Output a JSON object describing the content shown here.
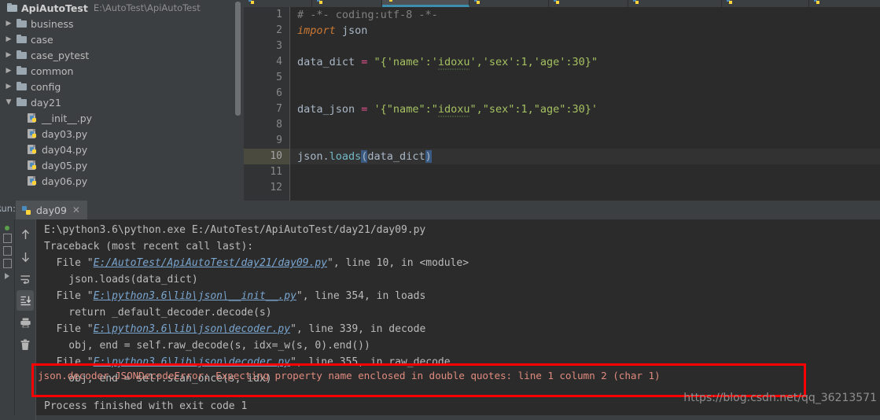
{
  "project": {
    "root": {
      "label": "ApiAutoTest",
      "path": "E:\\AutoTest\\ApiAutoTest",
      "icon": "folder-icon"
    },
    "items": [
      {
        "label": "business",
        "type": "folder",
        "expanded": false,
        "indent": 0
      },
      {
        "label": "case",
        "type": "folder",
        "expanded": false,
        "indent": 0
      },
      {
        "label": "case_pytest",
        "type": "folder",
        "expanded": false,
        "indent": 0
      },
      {
        "label": "common",
        "type": "folder",
        "expanded": false,
        "indent": 0
      },
      {
        "label": "config",
        "type": "folder",
        "expanded": false,
        "indent": 0
      },
      {
        "label": "day21",
        "type": "folder",
        "expanded": true,
        "indent": 0
      },
      {
        "label": "__init__.py",
        "type": "python",
        "indent": 1
      },
      {
        "label": "day03.py",
        "type": "python",
        "indent": 1
      },
      {
        "label": "day04.py",
        "type": "python",
        "indent": 1
      },
      {
        "label": "day05.py",
        "type": "python",
        "indent": 1
      },
      {
        "label": "day06.py",
        "type": "python",
        "indent": 1
      }
    ]
  },
  "editor": {
    "line_numbers": [
      "1",
      "2",
      "3",
      "4",
      "5",
      "6",
      "7",
      "8",
      "9",
      "10",
      "11",
      "12"
    ],
    "current_line": "10",
    "lines": [
      "# -*- coding:utf-8 -*-",
      "import json",
      "",
      "data_dict = \"{'name':'idoxu','sex':1,'age':30}\"",
      "",
      "",
      "data_json = '{\"name\":\"idoxu\",\"sex\":1,\"age\":30}'",
      "",
      "",
      "json.loads(data_dict)",
      "",
      ""
    ]
  },
  "run_panel": {
    "label": "Run:",
    "tab": {
      "label": "day09",
      "close_icon": "close-icon",
      "icon": "python-file-icon"
    },
    "toolbar": [
      {
        "name": "rerun-icon",
        "glyph": "↑"
      },
      {
        "name": "stop-icon",
        "glyph": "↓"
      },
      {
        "name": "soft-wrap-icon",
        "glyph": "⇥"
      },
      {
        "name": "scroll-to-end-icon",
        "glyph": "⤓",
        "selected": true
      },
      {
        "name": "print-icon",
        "glyph": "🖶"
      },
      {
        "name": "trash-icon",
        "glyph": "🗑"
      }
    ],
    "console_lines": [
      {
        "text": "E:\\python3.6\\python.exe E:/AutoTest/ApiAutoTest/day21/day09.py",
        "style": "out"
      },
      {
        "text": "Traceback (most recent call last):",
        "style": "err"
      },
      {
        "text": "  File \"E:/AutoTest/ApiAutoTest/day21/day09.py\", line 10, in <module>",
        "style": "err-link",
        "link": "E:/AutoTest/ApiAutoTest/day21/day09.py",
        "pre": "  File \"",
        "post": "\", line 10, in <module>"
      },
      {
        "text": "    json.loads(data_dict)",
        "style": "err"
      },
      {
        "text": "  File \"E:\\python3.6\\lib\\json\\__init__.py\", line 354, in loads",
        "style": "err-link",
        "link": "E:\\python3.6\\lib\\json\\__init__.py",
        "pre": "  File \"",
        "post": "\", line 354, in loads"
      },
      {
        "text": "    return _default_decoder.decode(s)",
        "style": "err"
      },
      {
        "text": "  File \"E:\\python3.6\\lib\\json\\decoder.py\", line 339, in decode",
        "style": "err-link",
        "link": "E:\\python3.6\\lib\\json\\decoder.py",
        "pre": "  File \"",
        "post": "\", line 339, in decode"
      },
      {
        "text": "    obj, end = self.raw_decode(s, idx=_w(s, 0).end())",
        "style": "err"
      },
      {
        "text": "  File \"E:\\python3.6\\lib\\json\\decoder.py\", line 355, in raw_decode",
        "style": "err-link",
        "link": "E:\\python3.6\\lib\\json\\decoder.py",
        "pre": "  File \"",
        "post": "\", line 355, in raw_decode"
      },
      {
        "text": "    obj, end = self.scan_once(s, idx)",
        "style": "err"
      }
    ],
    "error_line": "json.decoder.JSONDecodeError: Expecting property name enclosed in double quotes: line 1 column 2 (char 1)",
    "final_line": "Process finished with exit code 1"
  },
  "watermark": "https://blog.csdn.net/qq_36213571",
  "colors": {
    "highlight_box": "#ff0000",
    "editor_bg": "#2b2b2b",
    "panel_bg": "#3c3f41",
    "string": "#a5c261",
    "keyword": "#cc7832",
    "error_text": "#d0766c",
    "link": "#7aa6d0"
  }
}
